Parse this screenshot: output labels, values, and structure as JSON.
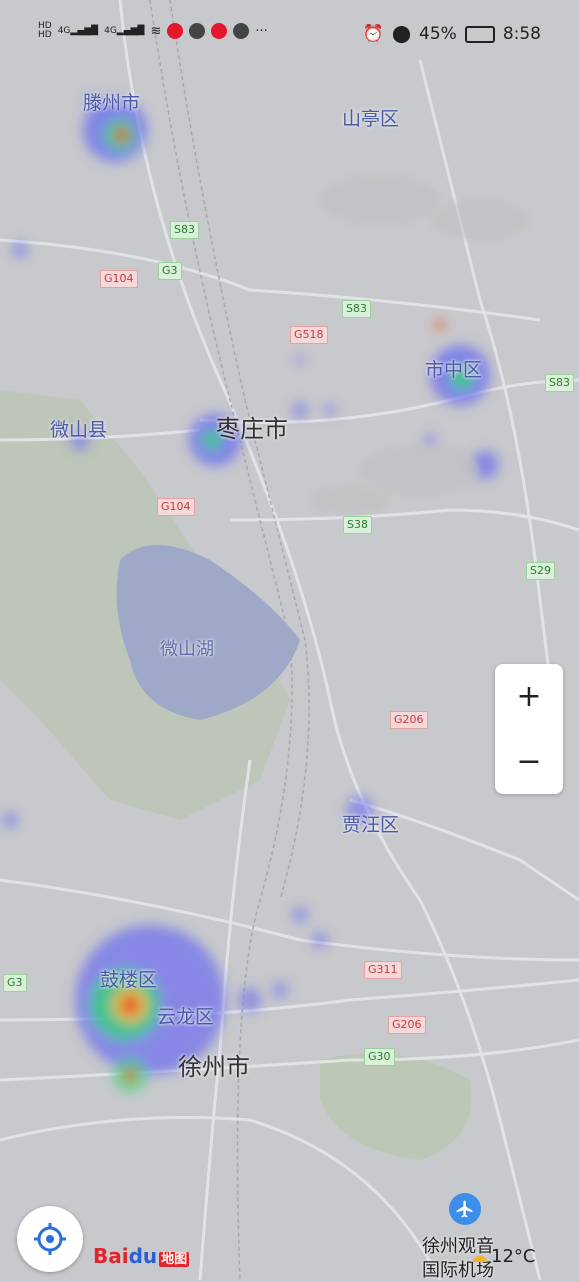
{
  "status_bar": {
    "left_icons": [
      "hd-icon",
      "signal-icon",
      "signal-icon",
      "wifi-icon",
      "weibo-icon",
      "wechat-icon",
      "weibo-icon",
      "browser-icon",
      "more-icon"
    ],
    "network_labels": [
      "4G",
      "4G"
    ],
    "more": "···",
    "battery": "45%",
    "time": "8:58"
  },
  "map": {
    "places": {
      "tengzhou": "滕州市",
      "shanting": "山亭区",
      "weishan_county": "微山县",
      "zaozhuang": "枣庄市",
      "shizhong": "市中区",
      "weishan_lake": "微山湖",
      "jiawang": "贾汪区",
      "gulou": "鼓楼区",
      "yunlong": "云龙区",
      "xuzhou": "徐州市",
      "airport_line1": "徐州观音",
      "airport_line2": "国际机场"
    },
    "roads": {
      "s83_a": "S83",
      "g104_a": "G104",
      "g3_a": "G3",
      "s83_b": "S83",
      "g518": "G518",
      "s83_c": "S83",
      "g104_b": "G104",
      "s38": "S38",
      "s29": "S29",
      "g206_a": "G206",
      "g311": "G311",
      "g206_b": "G206",
      "g30": "G30",
      "g3_b": "G3"
    }
  },
  "zoom": {
    "in_label": "+",
    "out_label": "−"
  },
  "logo": {
    "brand_red": "Bai",
    "brand_blue": "du",
    "suffix": "地图"
  },
  "weather": {
    "temperature": "12°C"
  },
  "colors": {
    "map_background": "#c8c9cc",
    "road": "#e2e3e6",
    "lake": "#9ea8c8",
    "green_area": "#b9c7b0",
    "heat_low": "#6b6cf0",
    "heat_mid": "#33d17a",
    "heat_high": "#e84a2a",
    "accent_blue": "#3d8eea"
  }
}
